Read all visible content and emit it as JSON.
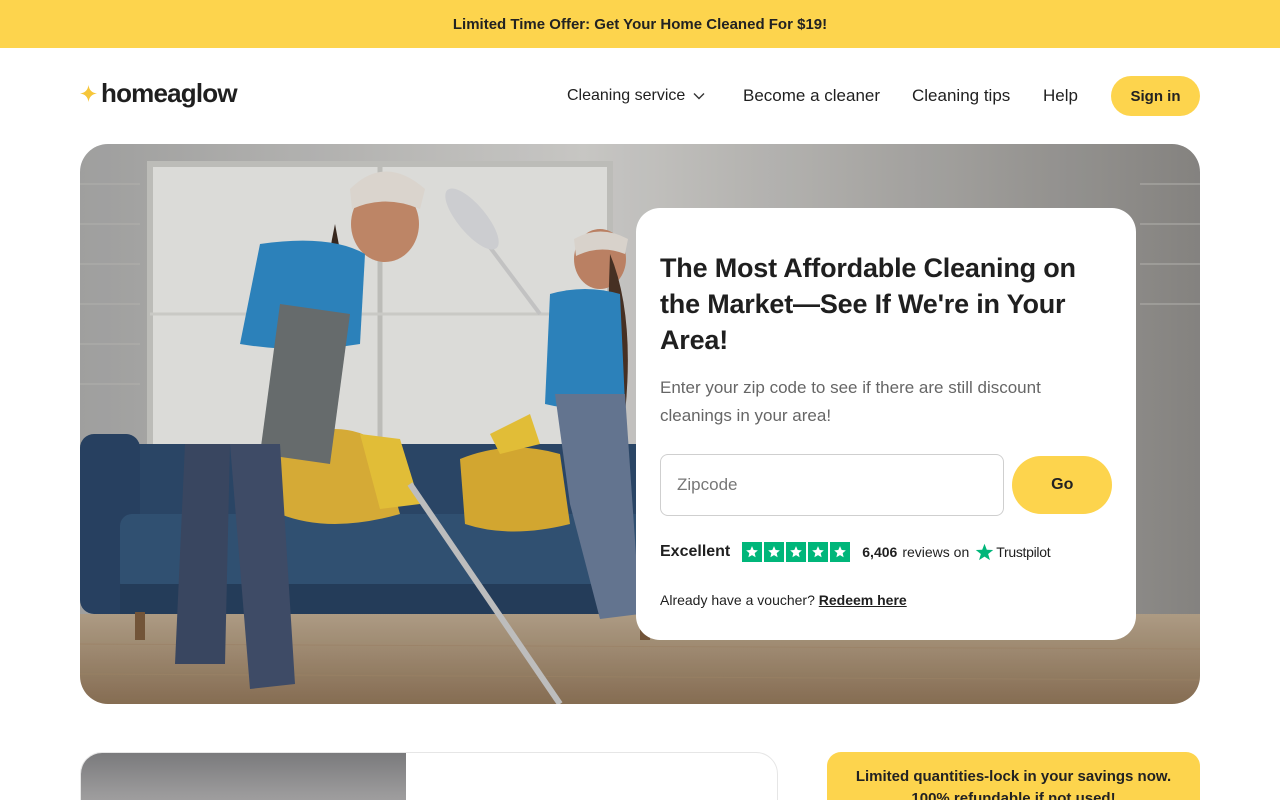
{
  "promo_bar": {
    "text": "Limited Time Offer: Get Your Home Cleaned For $19!"
  },
  "header": {
    "logo_text": "homeaglow",
    "nav": {
      "cleaning_service": "Cleaning service",
      "become_cleaner": "Become a cleaner",
      "cleaning_tips": "Cleaning tips",
      "help": "Help"
    },
    "sign_in": "Sign in"
  },
  "hero": {
    "title": "The Most Affordable Cleaning on the Market—See If We're in Your Area!",
    "subtitle": "Enter your zip code to see if there are still discount cleanings in your area!",
    "zip_placeholder": "Zipcode",
    "go_label": "Go",
    "rating": {
      "word": "Excellent",
      "stars": 5,
      "count": "6,406",
      "suffix": "reviews on",
      "platform": "Trustpilot"
    },
    "voucher": {
      "prompt": "Already have a voucher?",
      "link": "Redeem here"
    }
  },
  "savings_box": {
    "line1": "Limited quantities-lock in your savings now.",
    "line2": "100% refundable if not used!"
  },
  "colors": {
    "accent_yellow": "#fdd44d",
    "trustpilot_green": "#00b67a",
    "text_dark": "#1f1f1f"
  },
  "icons": {
    "logo": "sparkle-icon",
    "dropdown": "chevron-down-icon",
    "rating": "star-icon",
    "trustpilot": "trustpilot-star-icon"
  }
}
